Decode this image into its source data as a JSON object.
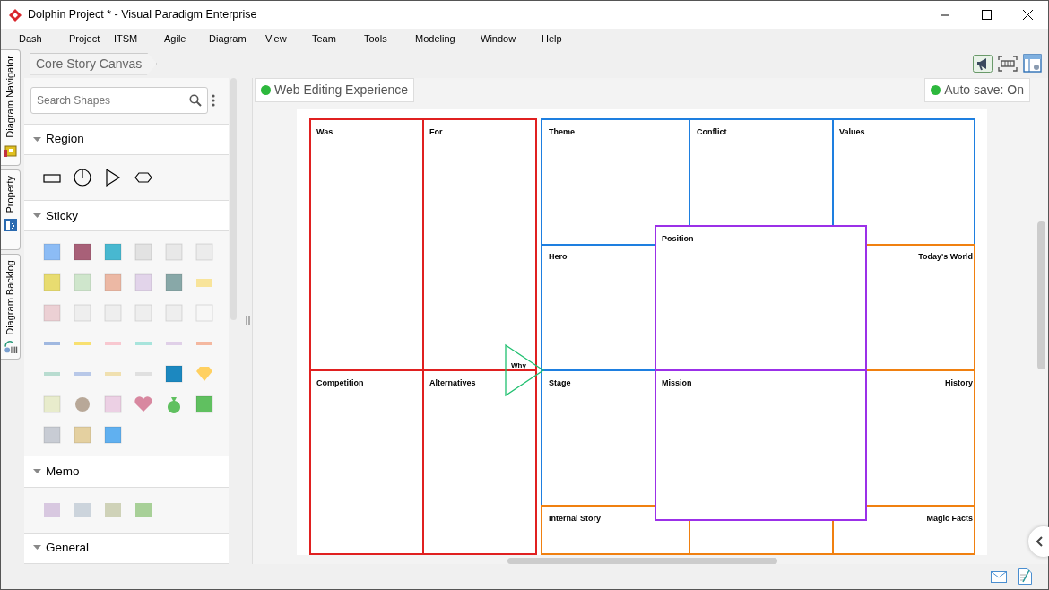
{
  "window": {
    "title": "Dolphin Project * - Visual Paradigm Enterprise"
  },
  "menu": [
    "Dash",
    "Project",
    "ITSM",
    "Agile",
    "Diagram",
    "View",
    "Team",
    "Tools",
    "Modeling",
    "Window",
    "Help"
  ],
  "side_tabs": [
    {
      "label": "Diagram Navigator"
    },
    {
      "label": "Property"
    },
    {
      "label": "Diagram Backlog"
    }
  ],
  "breadcrumb": "Core Story Canvas",
  "palette": {
    "search": {
      "placeholder": "Search Shapes"
    },
    "sections": [
      {
        "title": "Region",
        "kind": "region"
      },
      {
        "title": "Sticky",
        "kind": "sticky"
      },
      {
        "title": "Memo",
        "kind": "memo"
      },
      {
        "title": "General",
        "kind": "none"
      }
    ]
  },
  "diagram_title": "Web Editing Experience",
  "autosave": "Auto save: On",
  "canvas": {
    "cells": [
      {
        "label": "Was",
        "color": "#e02020"
      },
      {
        "label": "For",
        "color": "#e02020"
      },
      {
        "label": "Competition",
        "color": "#e02020"
      },
      {
        "label": "Alternatives",
        "color": "#e02020"
      },
      {
        "label": "Theme",
        "color": "#1e7fe0"
      },
      {
        "label": "Conflict",
        "color": "#1e7fe0"
      },
      {
        "label": "Values",
        "color": "#1e7fe0"
      },
      {
        "label": "Hero",
        "color": "#1e7fe0"
      },
      {
        "label": "Stage",
        "color": "#1e7fe0"
      },
      {
        "label": "Today's World",
        "color": "#f08010"
      },
      {
        "label": "History",
        "color": "#f08010"
      },
      {
        "label": "Internal Story",
        "color": "#f08010"
      },
      {
        "color": "#f08010"
      },
      {
        "label": "Magic Facts",
        "color": "#f08010"
      },
      {
        "label": "Position",
        "color": "#9b30e8"
      },
      {
        "label": "Mission",
        "color": "#9b30e8"
      }
    ],
    "why": {
      "label": "Why",
      "color": "#20c070"
    }
  }
}
